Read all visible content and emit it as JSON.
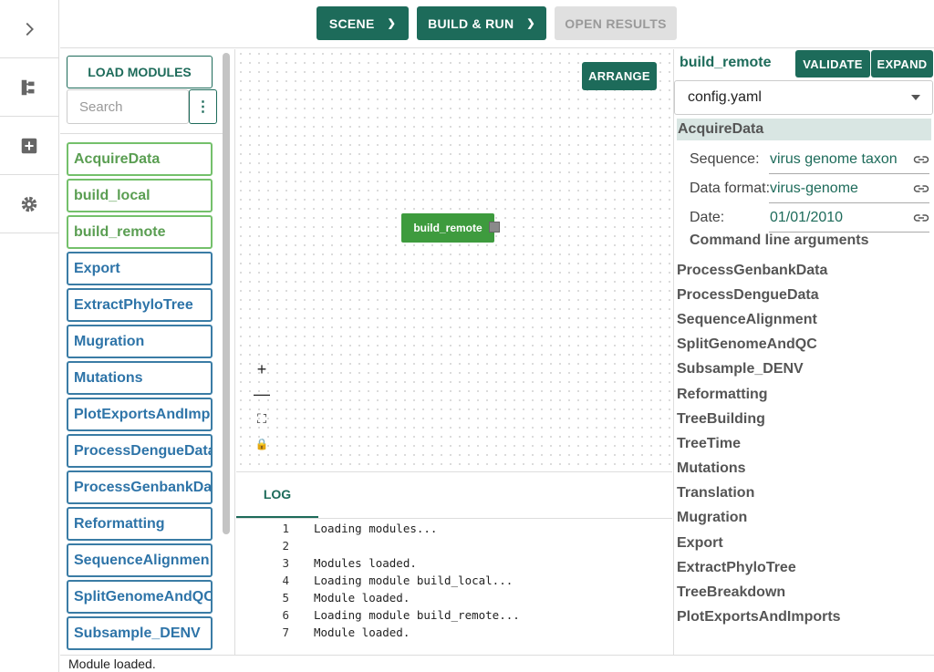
{
  "toolbar": {
    "scene_label": "SCENE",
    "build_run_label": "BUILD & RUN",
    "open_results_label": "OPEN RESULTS"
  },
  "sidebar": {
    "icons": [
      "chevron-right-icon",
      "tree-icon",
      "add-box-icon",
      "gear-icon"
    ]
  },
  "modules_panel": {
    "load_label": "LOAD MODULES",
    "search_placeholder": "Search",
    "modules": [
      {
        "label": "AcquireData",
        "color": "green"
      },
      {
        "label": "build_local",
        "color": "green"
      },
      {
        "label": "build_remote",
        "color": "green"
      },
      {
        "label": "Export",
        "color": "blue"
      },
      {
        "label": "ExtractPhyloTree",
        "color": "blue"
      },
      {
        "label": "Mugration",
        "color": "blue"
      },
      {
        "label": "Mutations",
        "color": "blue"
      },
      {
        "label": "PlotExportsAndImp",
        "color": "blue"
      },
      {
        "label": "ProcessDengueData",
        "color": "blue"
      },
      {
        "label": "ProcessGenbankDa",
        "color": "blue"
      },
      {
        "label": "Reformatting",
        "color": "blue"
      },
      {
        "label": "SequenceAlignmen",
        "color": "blue"
      },
      {
        "label": "SplitGenomeAndQC",
        "color": "blue"
      },
      {
        "label": "Subsample_DENV",
        "color": "blue"
      }
    ]
  },
  "canvas": {
    "arrange_label": "ARRANGE",
    "node_label": "build_remote",
    "zoom_controls": [
      "+",
      "—",
      "⛶",
      "🔒"
    ]
  },
  "log": {
    "tab_label": "LOG",
    "lines": [
      {
        "n": "1",
        "text": "Loading modules..."
      },
      {
        "n": "2",
        "text": ""
      },
      {
        "n": "3",
        "text": "Modules loaded."
      },
      {
        "n": "4",
        "text": "Loading module build_local..."
      },
      {
        "n": "5",
        "text": "Module loaded."
      },
      {
        "n": "6",
        "text": "Loading module build_remote..."
      },
      {
        "n": "7",
        "text": "Module loaded."
      }
    ]
  },
  "status_text": "Module loaded.",
  "config_panel": {
    "title": "build_remote",
    "validate_label": "VALIDATE",
    "expand_label": "EXPAND",
    "config_file": "config.yaml",
    "section": "AcquireData",
    "params": [
      {
        "label": "Sequence:",
        "value": "virus genome taxon"
      },
      {
        "label": "Data format:",
        "value": "virus-genome"
      },
      {
        "label": "Date:",
        "value": "01/01/2010"
      }
    ],
    "cla_label": "Command line arguments",
    "rules": [
      "ProcessGenbankData",
      "ProcessDengueData",
      "SequenceAlignment",
      "SplitGenomeAndQC",
      "Subsample_DENV",
      "Reformatting",
      "TreeBuilding",
      "TreeTime",
      "Mutations",
      "Translation",
      "Mugration",
      "Export",
      "ExtractPhyloTree",
      "TreeBreakdown",
      "PlotExportsAndImports"
    ]
  },
  "colors": {
    "accent": "#1d6b5a",
    "module_green": "#74c06b",
    "module_blue": "#3a7ca5",
    "node": "#3e9b3e"
  }
}
